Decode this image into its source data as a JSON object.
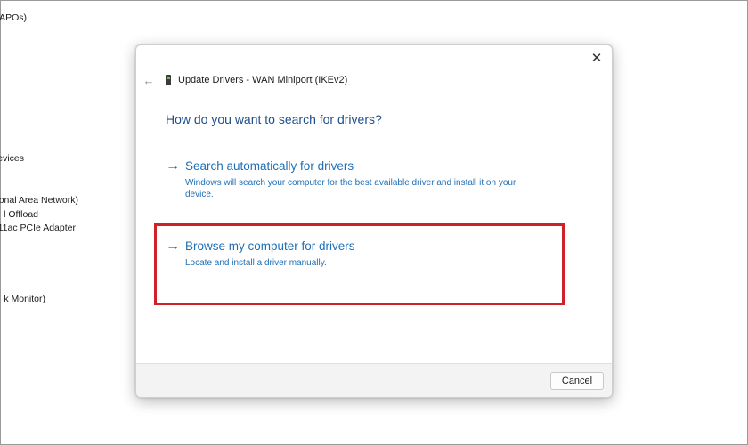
{
  "background_list": {
    "items": [
      "APOs)",
      "evices",
      "onal Area Network)",
      "l Offload",
      "11ac PCIe Adapter",
      "k Monitor)"
    ]
  },
  "dialog": {
    "title": "Update Drivers - WAN Miniport (IKEv2)",
    "close_glyph": "✕",
    "back_glyph": "←",
    "heading": "How do you want to search for drivers?",
    "options": [
      {
        "arrow": "→",
        "title": "Search automatically for drivers",
        "description": "Windows will search your computer for the best available driver and install it on your device."
      },
      {
        "arrow": "→",
        "title": "Browse my computer for drivers",
        "description": "Locate and install a driver manually."
      }
    ],
    "cancel_label": "Cancel"
  },
  "colors": {
    "accent": "#1f6fb6",
    "heading": "#1f4e8c",
    "highlight": "#d0202a"
  },
  "icons": {
    "device": "network-adapter-icon",
    "back": "back-arrow-icon",
    "close": "close-icon",
    "option": "arrow-right-icon"
  }
}
